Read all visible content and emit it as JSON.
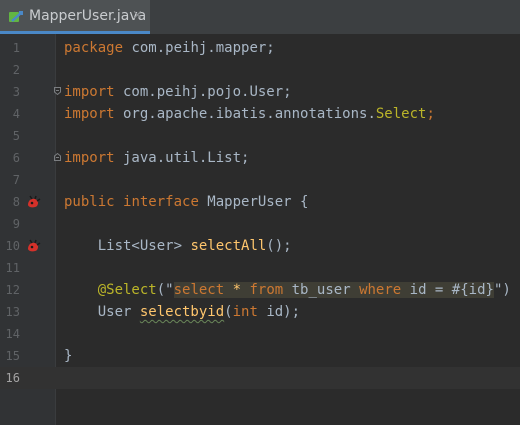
{
  "tab": {
    "filename": "MapperUser.java",
    "close": "×"
  },
  "lines": [
    {
      "num": "1"
    },
    {
      "num": "2"
    },
    {
      "num": "3"
    },
    {
      "num": "4"
    },
    {
      "num": "5"
    },
    {
      "num": "6"
    },
    {
      "num": "7"
    },
    {
      "num": "8"
    },
    {
      "num": "9"
    },
    {
      "num": "10"
    },
    {
      "num": "11"
    },
    {
      "num": "12"
    },
    {
      "num": "13"
    },
    {
      "num": "14"
    },
    {
      "num": "15"
    },
    {
      "num": "16"
    }
  ],
  "code": {
    "l1_kw": "package",
    "l1_rest": " com.peihj.mapper;",
    "l3_kw": "import",
    "l3_rest": " com.peihj.pojo.User;",
    "l4_kw": "import",
    "l4_rest": " org.apache.ibatis.annotations.",
    "l4_cls": "Select",
    "l4_end": ";",
    "l6_kw": "import",
    "l6_rest": " java.util.List;",
    "l8_kw1": "public",
    "l8_kw2": "interface",
    "l8_rest": " MapperUser {",
    "l10_type": "    List<User> ",
    "l10_fn": "selectAll",
    "l10_end": "();",
    "l12_indent": "    ",
    "l12_ann": "@Select",
    "l12_open": "(\"",
    "l12_s1": "select",
    "l12_s2": " ",
    "l12_s3": "*",
    "l12_s4": " ",
    "l12_s5": "from",
    "l12_s6": " tb_user ",
    "l12_s7": "where",
    "l12_s8": " id = #{id}",
    "l12_close": "\")",
    "l13_type": "    User ",
    "l13_fn": "selectbyid",
    "l13_open": "(",
    "l13_kw": "int",
    "l13_rest": " id);",
    "l15": "}"
  },
  "colors": {
    "keyword": "#cc7832",
    "annotation": "#bbb529",
    "method": "#ffc66d",
    "string": "#6a8759",
    "text": "#a9b7c6",
    "background": "#2b2b2b"
  },
  "icons": {
    "tab": "java-interface-icon",
    "gutter_line8": "mybatis-bean-icon",
    "gutter_line10": "mybatis-bean-icon"
  }
}
